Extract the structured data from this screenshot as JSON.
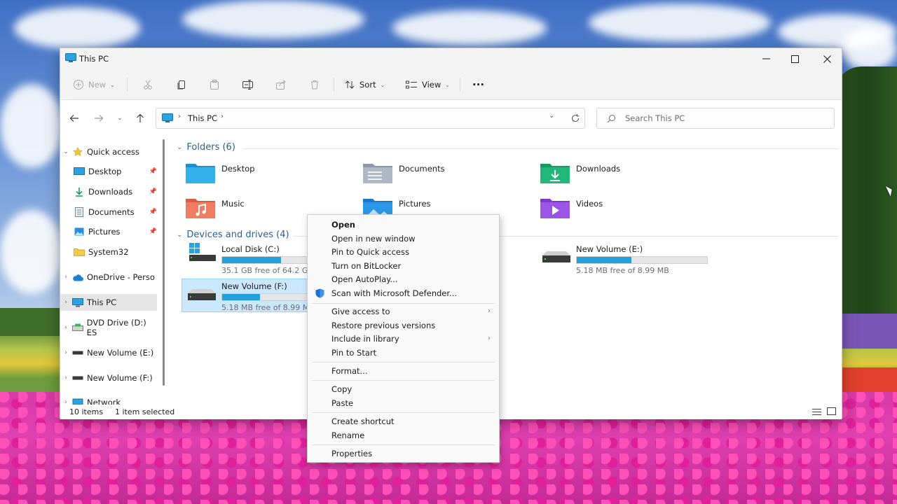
{
  "window": {
    "title": "This PC"
  },
  "toolbar": {
    "new_label": "New",
    "sort_label": "Sort",
    "view_label": "View",
    "more_label": "···"
  },
  "address": {
    "location": "This PC",
    "search_placeholder": "Search This PC"
  },
  "nav_pane": {
    "quick_access": "Quick access",
    "items": [
      {
        "label": "Desktop",
        "icon": "desktop-icon",
        "pinned": true
      },
      {
        "label": "Downloads",
        "icon": "downloads-icon",
        "pinned": true
      },
      {
        "label": "Documents",
        "icon": "documents-icon",
        "pinned": true
      },
      {
        "label": "Pictures",
        "icon": "pictures-icon",
        "pinned": true
      },
      {
        "label": "System32",
        "icon": "folder-icon",
        "pinned": false
      }
    ],
    "onedrive": "OneDrive - Perso",
    "this_pc": "This PC",
    "dvd": "DVD Drive (D:) ES",
    "vol_e": "New Volume (E:)",
    "vol_f": "New Volume (F:)",
    "network": "Network"
  },
  "content": {
    "folders_header": "Folders (6)",
    "folders": [
      {
        "label": "Desktop",
        "icon": "desktop-folder-icon"
      },
      {
        "label": "Documents",
        "icon": "documents-folder-icon"
      },
      {
        "label": "Downloads",
        "icon": "downloads-folder-icon"
      },
      {
        "label": "Music",
        "icon": "music-folder-icon"
      },
      {
        "label": "Pictures",
        "icon": "pictures-folder-icon"
      },
      {
        "label": "Videos",
        "icon": "videos-folder-icon"
      }
    ],
    "drives_header": "Devices and drives (4)",
    "drives": [
      {
        "name": "Local Disk (C:)",
        "free": "35.1 GB free of 64.2 GB",
        "used_fraction": 0.45
      },
      {
        "name": "New Volume (E:)",
        "free": "5.18 MB free of 8.99 MB",
        "used_fraction": 0.42
      },
      {
        "name": "New Volume (F:)",
        "free": "5.18 MB free of 8.99 MB",
        "used_fraction": 0.42
      }
    ]
  },
  "status": {
    "count": "10 items",
    "selection": "1 item selected"
  },
  "context_menu": {
    "items": [
      "Open",
      "Open in new window",
      "Pin to Quick access",
      "Turn on BitLocker",
      "Open AutoPlay...",
      "Scan with Microsoft Defender...",
      "Give access to",
      "Restore previous versions",
      "Include in library",
      "Pin to Start",
      "Format...",
      "Copy",
      "Paste",
      "Create shortcut",
      "Rename",
      "Properties"
    ]
  },
  "colors": {
    "accent": "#26a0da",
    "selection": "#cce8ff",
    "header_blue": "#2d5f8c"
  }
}
